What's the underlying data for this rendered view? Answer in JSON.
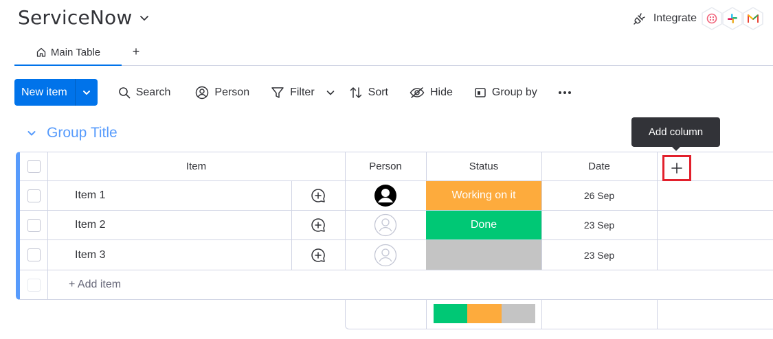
{
  "header": {
    "board_title": "ServiceNow",
    "integrate_label": "Integrate",
    "integration_icons": [
      "monday-apps-icon",
      "slack-icon",
      "gmail-icon"
    ]
  },
  "tabs": {
    "main_table": "Main Table",
    "add": "+"
  },
  "toolbar": {
    "new_item": "New item",
    "search": "Search",
    "person": "Person",
    "filter": "Filter",
    "sort": "Sort",
    "hide": "Hide",
    "group_by": "Group by"
  },
  "group": {
    "title": "Group Title",
    "color": "#579bfc"
  },
  "tooltip": {
    "text": "Add column"
  },
  "table": {
    "headers": {
      "item": "Item",
      "person": "Person",
      "status": "Status",
      "date": "Date"
    },
    "rows": [
      {
        "name": "Item 1",
        "person": "assigned",
        "status": "Working on it",
        "status_color": "#fdab3d",
        "date": "26 Sep"
      },
      {
        "name": "Item 2",
        "person": "empty",
        "status": "Done",
        "status_color": "#00c875",
        "date": "23 Sep"
      },
      {
        "name": "Item 3",
        "person": "empty",
        "status": "",
        "status_color": "#c4c4c4",
        "date": "23 Sep"
      }
    ],
    "add_item": "+ Add item"
  },
  "summary": {
    "status_distribution": [
      {
        "color": "#00c875",
        "fraction": 0.333
      },
      {
        "color": "#fdab3d",
        "fraction": 0.333
      },
      {
        "color": "#c4c4c4",
        "fraction": 0.334
      }
    ]
  },
  "colors": {
    "primary": "#0073ea",
    "highlight": "#e2202c",
    "done": "#00c875",
    "working": "#fdab3d",
    "empty_status": "#c4c4c4"
  }
}
